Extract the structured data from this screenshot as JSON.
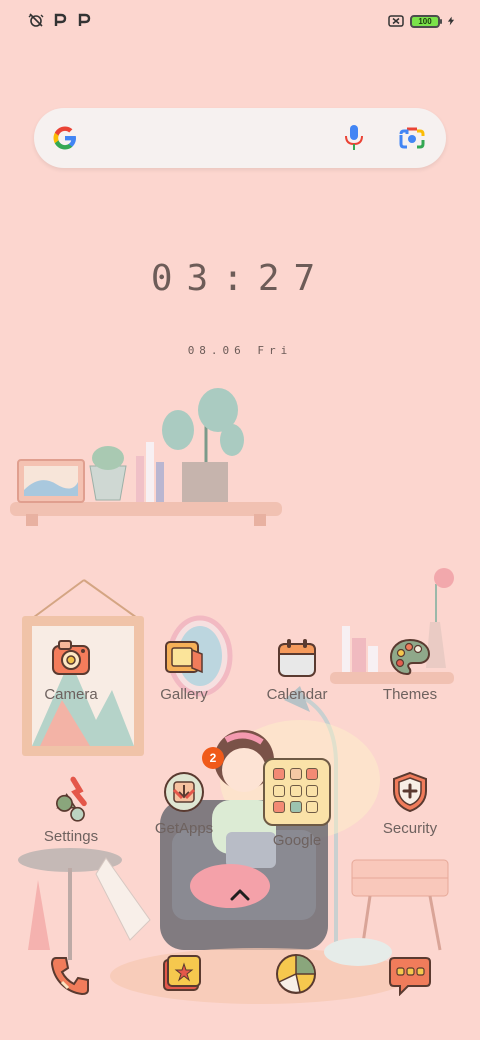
{
  "status_bar": {
    "left_icons": [
      "alarm-off-icon",
      "p-icon",
      "p-icon"
    ],
    "battery_level": "100",
    "right_icons": [
      "no-sim-icon",
      "battery-icon",
      "charging-icon"
    ]
  },
  "search": {
    "placeholder": "",
    "icons": [
      "google-logo-icon",
      "mic-icon",
      "lens-camera-icon"
    ]
  },
  "clock": {
    "time": "03:27",
    "date": "08.06 Fri"
  },
  "apps_row1": [
    {
      "label": "Camera"
    },
    {
      "label": "Gallery"
    },
    {
      "label": "Calendar"
    },
    {
      "label": "Themes"
    }
  ],
  "apps_row2": [
    {
      "label": "Settings"
    },
    {
      "label": "GetApps",
      "badge": "2"
    },
    {
      "label": "Google"
    },
    {
      "label": "Security"
    }
  ],
  "dock": {
    "icons": [
      "phone-icon",
      "messages-icon",
      "browser-icon",
      "chat-icon"
    ]
  },
  "colors": {
    "background": "#fcd6cf",
    "badge": "#f05a1a",
    "battery": "#7be34a"
  }
}
